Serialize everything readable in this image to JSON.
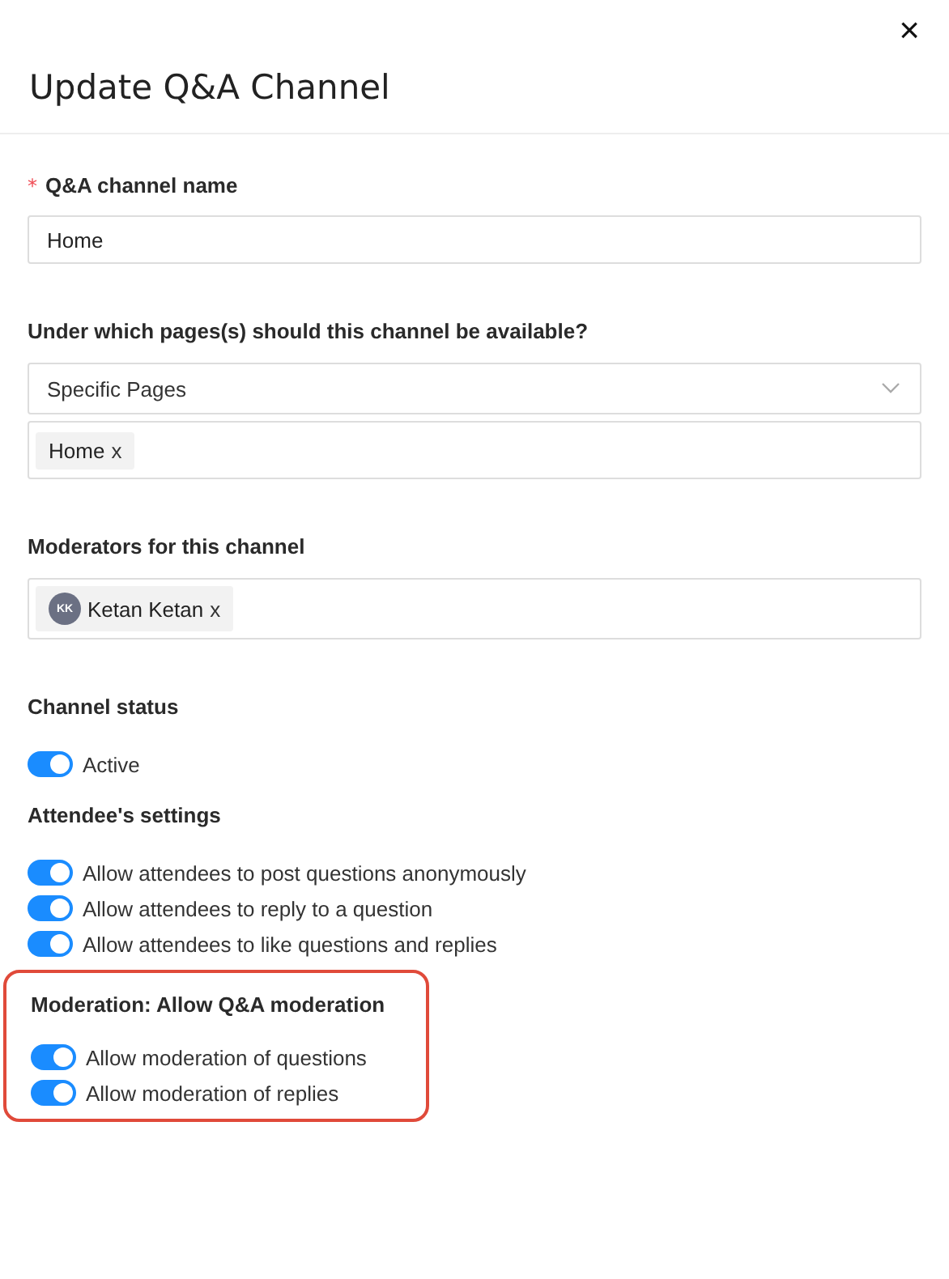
{
  "dialog": {
    "title": "Update Q&A Channel",
    "close": "×"
  },
  "name_field": {
    "label": "Q&A channel name",
    "required_mark": "*",
    "value": "Home"
  },
  "pages_field": {
    "label": "Under which pages(s) should this channel be available?",
    "value": "Specific Pages",
    "tags": [
      {
        "label": "Home",
        "remove": "x"
      }
    ]
  },
  "moderators_field": {
    "label": "Moderators for this channel",
    "tags": [
      {
        "initials": "KK",
        "label": "Ketan Ketan",
        "remove": "x"
      }
    ]
  },
  "sections": [
    {
      "heading": "Channel status",
      "highlighted": false,
      "toggles": [
        {
          "label": "Active",
          "on": true
        }
      ]
    },
    {
      "heading": "Attendee's settings",
      "highlighted": false,
      "toggles": [
        {
          "label": "Allow attendees to post questions anonymously",
          "on": true
        },
        {
          "label": "Allow attendees to reply to a question",
          "on": true
        },
        {
          "label": "Allow attendees to like questions and replies",
          "on": true
        }
      ]
    },
    {
      "heading": "Moderation: Allow Q&A moderation",
      "highlighted": true,
      "toggles": [
        {
          "label": "Allow moderation of questions",
          "on": true
        },
        {
          "label": "Allow moderation of replies",
          "on": true
        }
      ]
    }
  ]
}
